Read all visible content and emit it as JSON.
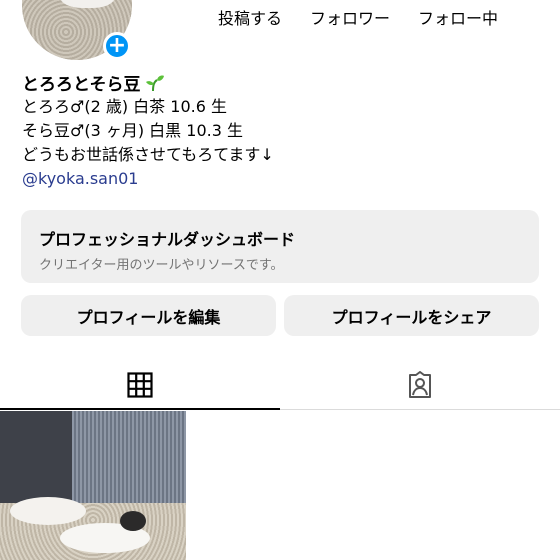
{
  "profile": {
    "stats_labels": [
      "投稿する",
      "フォロワー",
      "フォロー中"
    ],
    "name": "とろろとそら豆",
    "bio": [
      "とろろ♂(2 歳) 白茶 10.6 生",
      "そら豆♂(3 ヶ月) 白黒 10.3 生",
      "どうもお世話係させてもろてます↓"
    ],
    "link": "@kyoka.san01",
    "add_story_symbol": "+"
  },
  "dashboard": {
    "title": "プロフェッショナルダッシュボード",
    "subtitle": "クリエイター用のツールやリソースです。"
  },
  "buttons": {
    "edit_profile": "プロフィールを編集",
    "share_profile": "プロフィールをシェア"
  },
  "icons": {
    "add": "plus-icon",
    "sprout": "sprout-icon",
    "grid": "grid-icon",
    "tagged": "tagged-person-icon"
  },
  "colors": {
    "accent": "#0095f6",
    "link": "#2a3c8f",
    "button_bg": "#efefef"
  }
}
